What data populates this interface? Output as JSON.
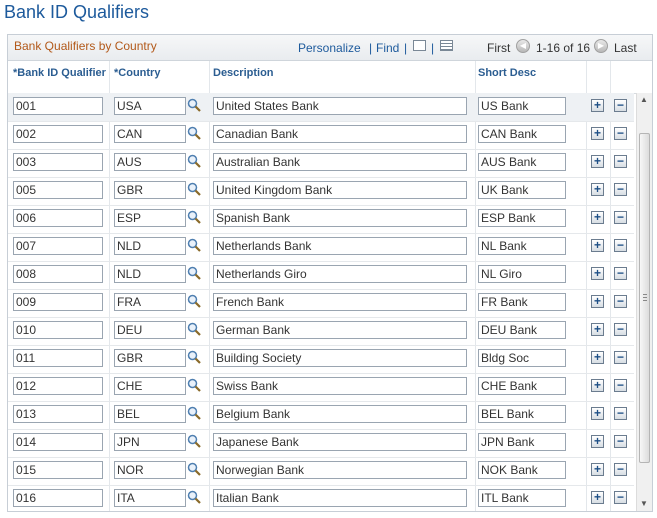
{
  "page_title": "Bank ID Qualifiers",
  "grid": {
    "caption": "Bank Qualifiers by Country",
    "personalize_label": "Personalize",
    "separator": "|",
    "find_label": "Find",
    "icons": [
      "view-all-icon",
      "download-icon"
    ],
    "nav": {
      "first_label": "First",
      "range_label": "1-16 of 16",
      "last_label": "Last"
    },
    "columns": {
      "bank_id_qualifier": "*Bank ID Qualifier",
      "country": "*Country",
      "description": "Description",
      "short_desc": "Short Desc"
    },
    "add_symbol": "+",
    "delete_symbol": "−",
    "rows": [
      {
        "qualifier": "001",
        "country": "USA",
        "description": "United States Bank",
        "short": "US Bank"
      },
      {
        "qualifier": "002",
        "country": "CAN",
        "description": "Canadian Bank",
        "short": "CAN Bank"
      },
      {
        "qualifier": "003",
        "country": "AUS",
        "description": "Australian Bank",
        "short": "AUS Bank"
      },
      {
        "qualifier": "005",
        "country": "GBR",
        "description": "United Kingdom Bank",
        "short": "UK Bank"
      },
      {
        "qualifier": "006",
        "country": "ESP",
        "description": "Spanish Bank",
        "short": "ESP Bank"
      },
      {
        "qualifier": "007",
        "country": "NLD",
        "description": "Netherlands Bank",
        "short": "NL Bank"
      },
      {
        "qualifier": "008",
        "country": "NLD",
        "description": "Netherlands Giro",
        "short": "NL Giro"
      },
      {
        "qualifier": "009",
        "country": "FRA",
        "description": "French Bank",
        "short": "FR Bank"
      },
      {
        "qualifier": "010",
        "country": "DEU",
        "description": "German Bank",
        "short": "DEU Bank"
      },
      {
        "qualifier": "011",
        "country": "GBR",
        "description": "Building Society",
        "short": "Bldg Soc"
      },
      {
        "qualifier": "012",
        "country": "CHE",
        "description": "Swiss Bank",
        "short": "CHE Bank"
      },
      {
        "qualifier": "013",
        "country": "BEL",
        "description": "Belgium Bank",
        "short": "BEL Bank"
      },
      {
        "qualifier": "014",
        "country": "JPN",
        "description": "Japanese Bank",
        "short": "JPN Bank"
      },
      {
        "qualifier": "015",
        "country": "NOR",
        "description": "Norwegian Bank",
        "short": "NOK Bank"
      },
      {
        "qualifier": "016",
        "country": "ITA",
        "description": "Italian Bank",
        "short": "ITL Bank"
      }
    ]
  },
  "colors": {
    "title": "#1d5a9c",
    "caption": "#b2591a",
    "header_text": "#2b5d91"
  }
}
